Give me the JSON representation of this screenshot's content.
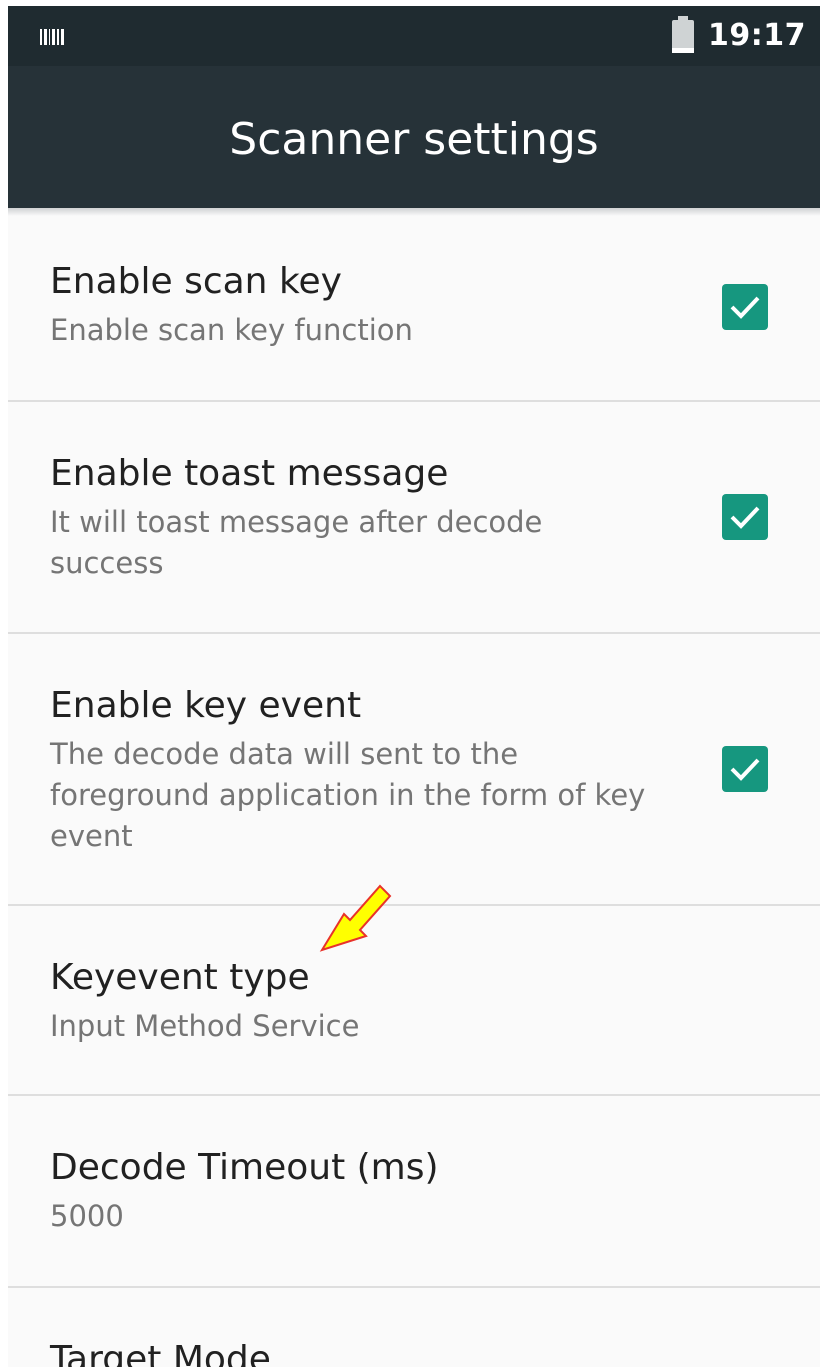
{
  "status_bar": {
    "time": "19:17",
    "left_icon": "barcode-icon",
    "right_icon": "battery-icon"
  },
  "app_bar": {
    "title": "Scanner settings"
  },
  "colors": {
    "app_bar": "#263238",
    "status_bar": "#1f2b30",
    "accent": "#16977f",
    "annotation_arrow": "#ffff00"
  },
  "preferences": [
    {
      "title": "Enable scan key",
      "summary": "Enable scan key function",
      "checked": true
    },
    {
      "title": "Enable toast message",
      "summary": "It will toast message after decode success",
      "checked": true
    },
    {
      "title": "Enable key event",
      "summary": "The decode data will sent to the foreground application in the form of key event",
      "checked": true
    },
    {
      "title": "Keyevent type",
      "summary": "Input Method Service"
    },
    {
      "title": "Decode Timeout (ms)",
      "summary": "5000"
    },
    {
      "title": "Target Mode"
    }
  ],
  "annotation": {
    "icon": "arrow-icon",
    "points_to": "Keyevent type"
  }
}
